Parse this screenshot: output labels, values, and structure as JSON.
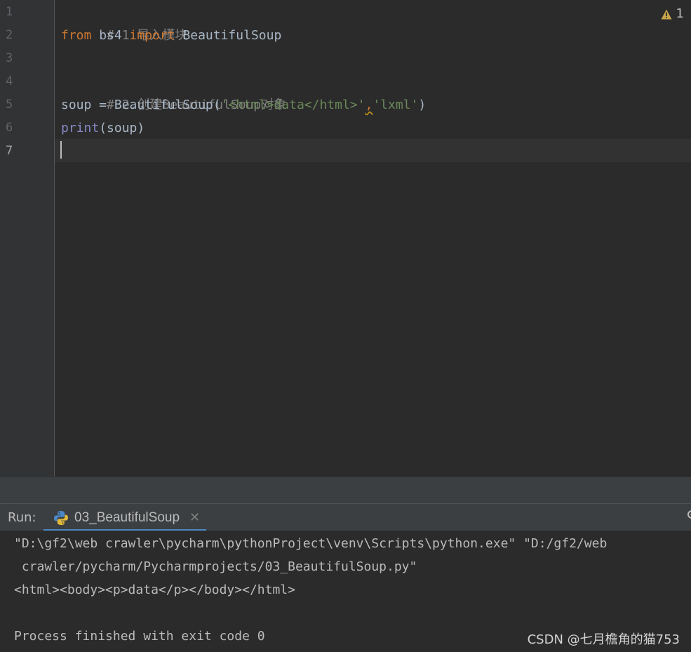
{
  "editor": {
    "line_numbers": [
      "1",
      "2",
      "3",
      "4",
      "5",
      "6",
      "7"
    ],
    "lines": {
      "l1_comment": "# 1.导入模块",
      "l2_from": "from",
      "l2_module": " bs4 ",
      "l2_import": "import",
      "l2_name": " BeautifulSoup",
      "l4_comment": "# 2.创建BeautifulSoup对象",
      "l5_prefix": "soup = BeautifulSoup(",
      "l5_str1": "'<html>data</html>'",
      "l5_comma": ",",
      "l5_str2": "'lxml'",
      "l5_suffix": ")",
      "l6_print": "print",
      "l6_args": "(soup)"
    },
    "warning_count": "1"
  },
  "run_window": {
    "label": "Run:",
    "tab_label": "03_BeautifulSoup",
    "close_glyph": "✕"
  },
  "console": {
    "line1": "\"D:\\gf2\\web crawler\\pycharm\\pythonProject\\venv\\Scripts\\python.exe\" \"D:/gf2/web",
    "line2": " crawler/pycharm/Pycharmprojects/03_BeautifulSoup.py\"",
    "line3": "<html><body><p>data</p></body></html>",
    "line5": "Process finished with exit code 0"
  },
  "watermark": "CSDN @七月檐角的猫753",
  "colors": {
    "background": "#2b2b2b",
    "keyword": "#cc7832",
    "string": "#6a8759",
    "comment": "#808080",
    "builtin": "#8888c6",
    "tab_accent": "#4a88c7"
  },
  "icons": {
    "warning": "warning-icon",
    "run_tab": "python-icon",
    "close": "close-icon"
  }
}
